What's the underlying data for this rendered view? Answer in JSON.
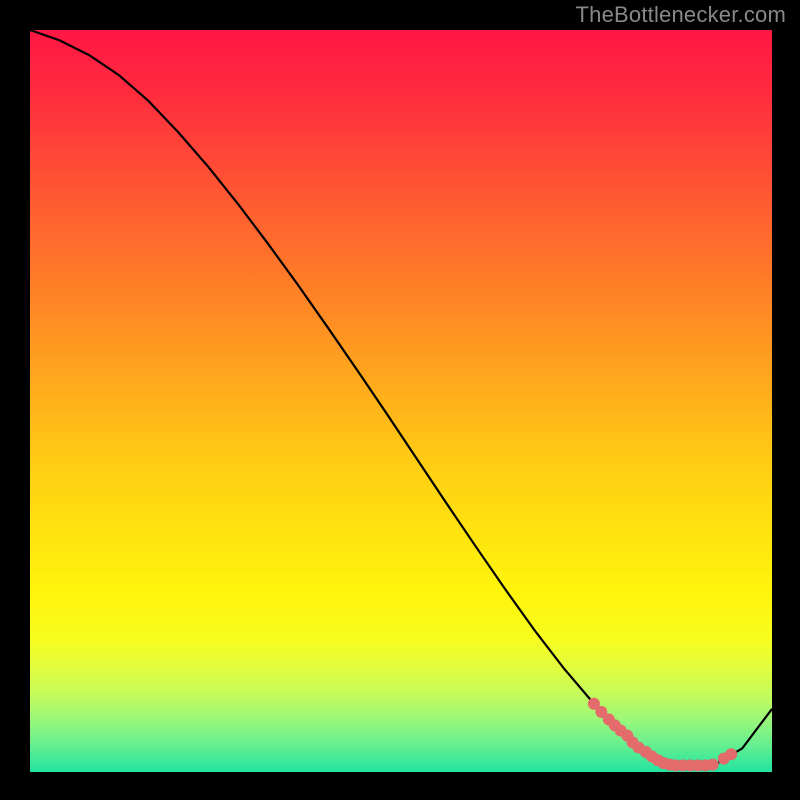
{
  "attribution": "TheBottlenecker.com",
  "chart_data": {
    "type": "line",
    "title": "",
    "xlabel": "",
    "ylabel": "",
    "xlim": [
      0,
      100
    ],
    "ylim": [
      0,
      100
    ],
    "series": [
      {
        "name": "curve",
        "x": [
          0,
          4,
          8,
          12,
          16,
          20,
          24,
          28,
          32,
          36,
          40,
          44,
          48,
          52,
          56,
          60,
          64,
          68,
          72,
          76,
          80,
          84,
          88,
          92,
          96,
          100
        ],
        "y": [
          100,
          98.6,
          96.6,
          93.9,
          90.4,
          86.2,
          81.6,
          76.6,
          71.3,
          65.8,
          60.1,
          54.3,
          48.4,
          42.4,
          36.4,
          30.5,
          24.7,
          19.1,
          13.9,
          9.2,
          5.3,
          2.4,
          0.8,
          0.8,
          3.2,
          8.5
        ]
      }
    ],
    "scatter_points": {
      "name": "markers",
      "color": "#e46b6b",
      "points": [
        {
          "x": 76.0,
          "y": 9.2
        },
        {
          "x": 77.0,
          "y": 8.1
        },
        {
          "x": 78.0,
          "y": 7.1
        },
        {
          "x": 78.8,
          "y": 6.3
        },
        {
          "x": 79.6,
          "y": 5.6
        },
        {
          "x": 80.5,
          "y": 4.9
        },
        {
          "x": 81.2,
          "y": 4.0
        },
        {
          "x": 82.0,
          "y": 3.3
        },
        {
          "x": 83.0,
          "y": 2.7
        },
        {
          "x": 83.8,
          "y": 2.1
        },
        {
          "x": 84.6,
          "y": 1.6
        },
        {
          "x": 85.4,
          "y": 1.2
        },
        {
          "x": 86.2,
          "y": 1.0
        },
        {
          "x": 87.0,
          "y": 0.9
        },
        {
          "x": 88.0,
          "y": 0.9
        },
        {
          "x": 89.0,
          "y": 0.9
        },
        {
          "x": 90.0,
          "y": 0.9
        },
        {
          "x": 91.0,
          "y": 0.9
        },
        {
          "x": 92.0,
          "y": 1.0
        },
        {
          "x": 93.5,
          "y": 1.8
        },
        {
          "x": 94.5,
          "y": 2.4
        }
      ]
    },
    "gradient_stops": [
      {
        "offset": 0.0,
        "color": "#ff1744"
      },
      {
        "offset": 0.08,
        "color": "#ff2a3f"
      },
      {
        "offset": 0.18,
        "color": "#ff4a36"
      },
      {
        "offset": 0.28,
        "color": "#ff6a2d"
      },
      {
        "offset": 0.38,
        "color": "#ff8a24"
      },
      {
        "offset": 0.48,
        "color": "#ffab1c"
      },
      {
        "offset": 0.58,
        "color": "#ffcb14"
      },
      {
        "offset": 0.68,
        "color": "#ffe40f"
      },
      {
        "offset": 0.76,
        "color": "#fff50c"
      },
      {
        "offset": 0.82,
        "color": "#f7fd1e"
      },
      {
        "offset": 0.86,
        "color": "#e2fd3f"
      },
      {
        "offset": 0.9,
        "color": "#c0fb5e"
      },
      {
        "offset": 0.93,
        "color": "#99f77a"
      },
      {
        "offset": 0.96,
        "color": "#6cf08e"
      },
      {
        "offset": 0.985,
        "color": "#3de99a"
      },
      {
        "offset": 1.0,
        "color": "#22e3a0"
      }
    ]
  }
}
